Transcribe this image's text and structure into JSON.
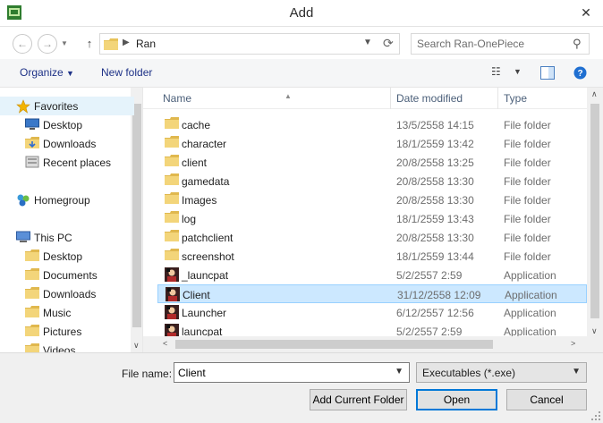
{
  "window": {
    "title": "Add"
  },
  "address": {
    "path": "Ran"
  },
  "search": {
    "placeholder": "Search Ran-OnePiece"
  },
  "toolbar": {
    "organize": "Organize",
    "new_folder": "New folder"
  },
  "nav": {
    "items": [
      {
        "label": "Favorites",
        "icon": "star-icon",
        "indent": 0,
        "active": true
      },
      {
        "label": "Desktop",
        "icon": "desktop-icon",
        "indent": 1
      },
      {
        "label": "Downloads",
        "icon": "downloads-icon",
        "indent": 1
      },
      {
        "label": "Recent places",
        "icon": "recent-places-icon",
        "indent": 1
      },
      {
        "label": "Homegroup",
        "icon": "homegroup-icon",
        "indent": 0
      },
      {
        "label": "This PC",
        "icon": "computer-icon",
        "indent": 0
      },
      {
        "label": "Desktop",
        "icon": "folder-icon",
        "indent": 1
      },
      {
        "label": "Documents",
        "icon": "folder-icon",
        "indent": 1
      },
      {
        "label": "Downloads",
        "icon": "folder-icon",
        "indent": 1
      },
      {
        "label": "Music",
        "icon": "folder-icon",
        "indent": 1
      },
      {
        "label": "Pictures",
        "icon": "folder-icon",
        "indent": 1
      },
      {
        "label": "Videos",
        "icon": "folder-icon",
        "indent": 1
      }
    ]
  },
  "columns": {
    "name": "Name",
    "date": "Date modified",
    "type": "Type"
  },
  "files": [
    {
      "name": "cache",
      "date": "13/5/2558 14:15",
      "type": "File folder",
      "icon": "folder-icon"
    },
    {
      "name": "character",
      "date": "18/1/2559 13:42",
      "type": "File folder",
      "icon": "folder-icon"
    },
    {
      "name": "client",
      "date": "20/8/2558 13:25",
      "type": "File folder",
      "icon": "folder-icon"
    },
    {
      "name": "gamedata",
      "date": "20/8/2558 13:30",
      "type": "File folder",
      "icon": "folder-icon"
    },
    {
      "name": "Images",
      "date": "20/8/2558 13:30",
      "type": "File folder",
      "icon": "folder-icon"
    },
    {
      "name": "log",
      "date": "18/1/2559 13:43",
      "type": "File folder",
      "icon": "folder-icon"
    },
    {
      "name": "patchclient",
      "date": "20/8/2558 13:30",
      "type": "File folder",
      "icon": "folder-icon"
    },
    {
      "name": "screenshot",
      "date": "18/1/2559 13:44",
      "type": "File folder",
      "icon": "folder-icon"
    },
    {
      "name": "_launcpat",
      "date": "5/2/2557 2:59",
      "type": "Application",
      "icon": "app-icon"
    },
    {
      "name": "Client",
      "date": "31/12/2558 12:09",
      "type": "Application",
      "icon": "app-icon",
      "selected": true
    },
    {
      "name": "Launcher",
      "date": "6/12/2557 12:56",
      "type": "Application",
      "icon": "app-icon"
    },
    {
      "name": "launcpat",
      "date": "5/2/2557 2:59",
      "type": "Application",
      "icon": "app-icon"
    }
  ],
  "footer": {
    "file_name_label": "File name:",
    "file_name_value": "Client",
    "file_type": "Executables (*.exe)",
    "add_current_folder": "Add Current Folder",
    "open": "Open",
    "cancel": "Cancel"
  },
  "colors": {
    "selection": "#cce8ff",
    "link": "#1e3287",
    "folder": "#e8c35a"
  }
}
